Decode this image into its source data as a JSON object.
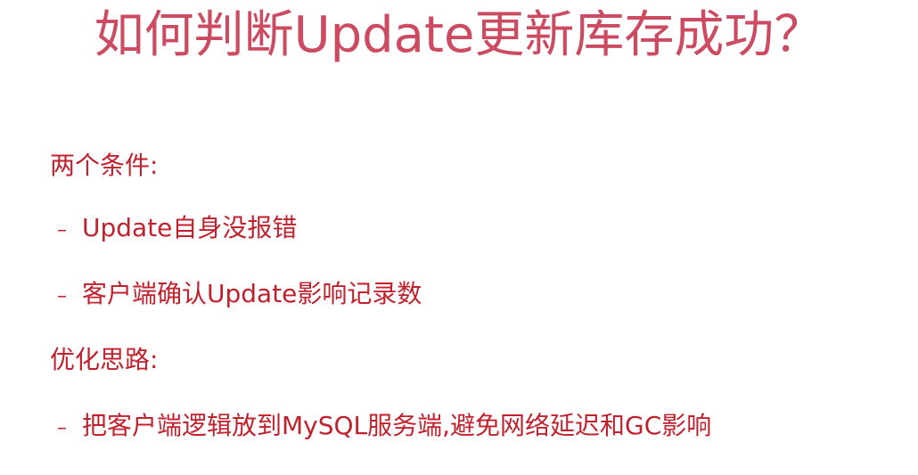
{
  "slide": {
    "title": "如何判断Update更新库存成功？",
    "section1": {
      "heading": "两个条件:",
      "items": [
        "Update自身没报错",
        "客户端确认Update影响记录数"
      ]
    },
    "section2": {
      "heading": "优化思路:",
      "items": [
        "把客户端逻辑放到MySQL服务端,避免网络延迟和GC影响"
      ]
    },
    "bullet_marker": "–"
  },
  "colors": {
    "title": "#cc4b61",
    "body_text": "#c0212d",
    "background": "#ffffff"
  }
}
